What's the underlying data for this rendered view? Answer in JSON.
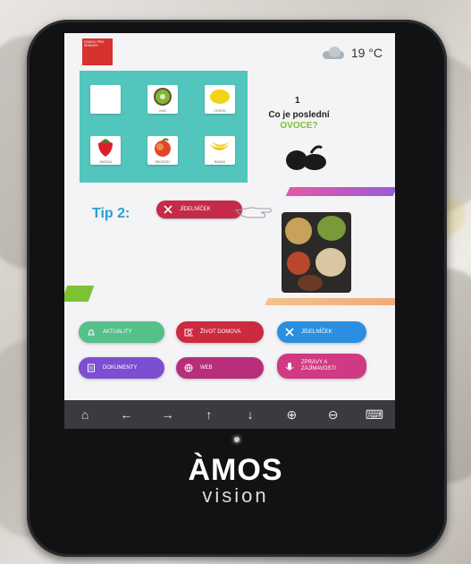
{
  "header": {
    "logo_text": "DOMOV PRO SENIORY",
    "temperature": "19 °C",
    "weather_icon": "cloud-icon"
  },
  "quiz": {
    "number": "1",
    "question_prefix": "Co je poslední",
    "question_highlight": "OVOCE?",
    "tiles": [
      {
        "label": "",
        "fruit": "blank"
      },
      {
        "label": "KIWI",
        "fruit": "kiwi"
      },
      {
        "label": "CITRON",
        "fruit": "lemon"
      },
      {
        "label": "JAHODA",
        "fruit": "strawberry"
      },
      {
        "label": "BROSKEV",
        "fruit": "peach"
      },
      {
        "label": "BANÁN",
        "fruit": "banana"
      }
    ]
  },
  "tip": {
    "label": "Tip 2:",
    "button_label": "JÍDELNÍČEK"
  },
  "menu": {
    "aktuality": "AKTUALITY",
    "zivot": "ŽIVOT DOMOVA",
    "jidelnicek": "JÍDELNÍČEK",
    "dokumenty": "DOKUMENTY",
    "web": "WEB",
    "zpravy": "ZPRÁVY A ZAJÍMAVOSTI"
  },
  "colors": {
    "aktuality": "#56c08a",
    "zivot": "#cc2a3f",
    "jidelnicek": "#2a8fe0",
    "dokumenty": "#7b4fd0",
    "web": "#b72e7a",
    "zpravy": "#d03a82",
    "tip": "#c62a49"
  },
  "navbar": {
    "home": "⌂",
    "back": "←",
    "forward": "→",
    "up": "↑",
    "down": "↓",
    "zoom_in": "⊕",
    "zoom_out": "⊖",
    "keyboard": "⌨"
  },
  "brand": {
    "name": "ÀMOS",
    "sub": "vision"
  }
}
